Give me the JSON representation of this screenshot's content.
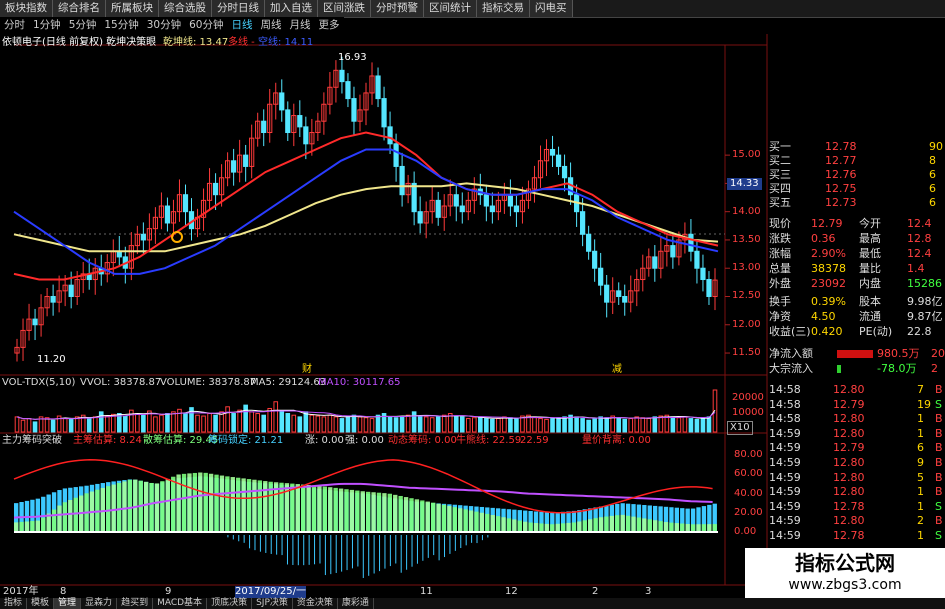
{
  "top_menu": [
    "板块指数",
    "综合排名",
    "所属板块",
    "综合选股",
    "分时日线",
    "加入自选",
    "区间涨跌",
    "分时预警",
    "区间统计",
    "指标交易",
    "闪电买"
  ],
  "periods": {
    "items": [
      "分时",
      "1分钟",
      "5分钟",
      "15分钟",
      "30分钟",
      "60分钟",
      "日线",
      "周线",
      "月线",
      "更多"
    ],
    "active": "日线"
  },
  "main_header": {
    "title": "依顿电子(日线 前复权) 乾坤决策眼",
    "indicator": "乾坤线: 13.47",
    "line2": "多线 -",
    "line3": "空线: 14.11"
  },
  "price_labels": {
    "high": "16.93",
    "low": "11.20"
  },
  "markers": {
    "cai": "财",
    "jian": "减"
  },
  "vol_header": {
    "name": "VOL-TDX(5,10)",
    "vvol": "VVOL: 38378.87",
    "volume": "VOLUME: 38378.87",
    "ma5": "MA5: 29124.63",
    "ma10": "MA10: 30117.65"
  },
  "chip_header": {
    "name": "主力筹码突破",
    "items": [
      "主筹估算: 8.24",
      "散筹估算: 29.45",
      "筹码锁定: 21.21",
      "涨: 0.00",
      "强: 0.00",
      "动态筹码: 0.00",
      "牛熊线: 22.59",
      "22.59",
      "量价背离: 0.00"
    ]
  },
  "axis": {
    "price_ticks": [
      "15.00",
      "14.50",
      "14.00",
      "13.50",
      "13.00",
      "12.50",
      "12.00",
      "11.50"
    ],
    "current_price_tag": "14.33",
    "vol_ticks": [
      "20000",
      "10000"
    ],
    "vol_unit": "X10",
    "chip_ticks": [
      "80.00",
      "60.00",
      "40.00",
      "20.00",
      "0.00"
    ],
    "date_labels": [
      "2017年",
      "8",
      "9",
      "2017/09/25/一",
      "11",
      "12",
      "2",
      "3"
    ]
  },
  "quote": {
    "buy": [
      {
        "label": "买一",
        "price": "12.78",
        "vol": "90"
      },
      {
        "label": "买二",
        "price": "12.77",
        "vol": "8"
      },
      {
        "label": "买三",
        "price": "12.76",
        "vol": "6"
      },
      {
        "label": "买四",
        "price": "12.75",
        "vol": "6"
      },
      {
        "label": "买五",
        "price": "12.73",
        "vol": "6"
      }
    ],
    "stats": [
      {
        "l1": "现价",
        "v1": "12.79",
        "l2": "今开",
        "v2": "12.4"
      },
      {
        "l1": "涨跌",
        "v1": "0.36",
        "l2": "最高",
        "v2": "12.8"
      },
      {
        "l1": "涨幅",
        "v1": "2.90%",
        "l2": "最低",
        "v2": "12.4"
      },
      {
        "l1": "总量",
        "v1": "38378",
        "l2": "量比",
        "v2": "1.4"
      },
      {
        "l1": "外盘",
        "v1": "23092",
        "l2": "内盘",
        "v2": "15286"
      },
      {
        "l1": "换手",
        "v1": "0.39%",
        "l2": "股本",
        "v2": "9.98亿"
      },
      {
        "l1": "净资",
        "v1": "4.50",
        "l2": "流通",
        "v2": "9.87亿"
      },
      {
        "l1": "收益(三)",
        "v1": "0.420",
        "l2": "PE(动)",
        "v2": "22.8"
      }
    ],
    "flow": [
      {
        "label": "净流入额",
        "value": "980.5万",
        "extra": "20"
      },
      {
        "label": "大宗流入",
        "value": "-78.0万",
        "extra": "2"
      }
    ],
    "ticks": [
      {
        "t": "14:58",
        "p": "12.80",
        "v": "7",
        "d": "B"
      },
      {
        "t": "14:58",
        "p": "12.79",
        "v": "19",
        "d": "S"
      },
      {
        "t": "14:58",
        "p": "12.80",
        "v": "1",
        "d": "B"
      },
      {
        "t": "14:59",
        "p": "12.80",
        "v": "1",
        "d": "B"
      },
      {
        "t": "14:59",
        "p": "12.79",
        "v": "6",
        "d": "B"
      },
      {
        "t": "14:59",
        "p": "12.80",
        "v": "9",
        "d": "B"
      },
      {
        "t": "14:59",
        "p": "12.80",
        "v": "5",
        "d": "B"
      },
      {
        "t": "14:59",
        "p": "12.80",
        "v": "1",
        "d": "B"
      },
      {
        "t": "14:59",
        "p": "12.78",
        "v": "1",
        "d": "S"
      },
      {
        "t": "14:59",
        "p": "12.80",
        "v": "2",
        "d": "B"
      },
      {
        "t": "14:59",
        "p": "12.78",
        "v": "1",
        "d": "S"
      }
    ]
  },
  "bottom_tabs": {
    "items": [
      "指标",
      "模板",
      "管理",
      "显森力",
      "趋买到",
      "MACD基本",
      "顶底决策",
      "SJP决策",
      "资金决策",
      "康彩通"
    ],
    "active": "管理"
  },
  "watermark": {
    "text1": "指标公式网",
    "text2": "www.zbgs3.com"
  },
  "colors": {
    "up": "#ff3b3b",
    "down": "#55e6ff",
    "yellow_line": "#f0e68c",
    "red_line": "#ff2a2a",
    "blue_line": "#2a3cff",
    "chip_green": "#7dff7d",
    "chip_cyan": "#3cc8ff",
    "purple_line": "#c050ff",
    "quote_up": "#ff4040",
    "quote_down": "#40ff40"
  },
  "chart_data": [
    {
      "type": "candlestick",
      "title": "依顿电子(日线 前复权)",
      "ylim": [
        11.2,
        16.93
      ],
      "ticks": [
        15.0,
        14.5,
        14.0,
        13.5,
        13.0,
        12.5,
        12.0,
        11.5
      ],
      "close": [
        11.6,
        11.9,
        12.1,
        12.0,
        12.3,
        12.5,
        12.4,
        12.6,
        12.7,
        12.5,
        12.8,
        12.9,
        12.8,
        13.0,
        12.9,
        13.1,
        13.3,
        13.2,
        13.0,
        13.4,
        13.6,
        13.5,
        13.7,
        13.9,
        14.1,
        13.8,
        14.0,
        14.3,
        14.0,
        13.7,
        13.9,
        14.2,
        14.5,
        14.3,
        14.6,
        14.9,
        14.7,
        15.0,
        14.8,
        15.3,
        15.6,
        15.4,
        15.9,
        16.1,
        15.8,
        15.4,
        15.7,
        15.5,
        15.2,
        15.4,
        15.6,
        15.9,
        16.2,
        16.5,
        16.3,
        16.0,
        15.6,
        15.8,
        16.1,
        16.4,
        16.0,
        15.5,
        15.2,
        14.8,
        14.3,
        14.5,
        14.0,
        13.8,
        14.0,
        14.2,
        13.9,
        14.1,
        14.3,
        14.1,
        14.0,
        14.2,
        14.4,
        14.3,
        14.1,
        14.0,
        14.2,
        14.3,
        14.1,
        14.0,
        14.2,
        14.4,
        14.6,
        14.9,
        15.1,
        15.0,
        14.8,
        14.6,
        14.3,
        14.0,
        13.6,
        13.3,
        13.0,
        12.7,
        12.4,
        12.6,
        12.5,
        12.4,
        12.6,
        12.8,
        13.0,
        13.2,
        13.0,
        13.3,
        13.4,
        13.2,
        13.5,
        13.6,
        13.3,
        13.0,
        12.8,
        12.5,
        12.79
      ],
      "series": [
        {
          "name": "乾坤线",
          "values": [
            13.6,
            13.5,
            13.4,
            13.3,
            13.3,
            13.3,
            13.3,
            13.4,
            13.5,
            13.6,
            13.75,
            13.95,
            14.15,
            14.3,
            14.4,
            14.45,
            14.45,
            14.45,
            14.5,
            14.45,
            14.4,
            14.3,
            14.2,
            14.1,
            13.95,
            13.8,
            13.65,
            13.5,
            13.47
          ]
        },
        {
          "name": "多线",
          "values": [
            12.9,
            12.8,
            12.8,
            12.9,
            13.0,
            13.2,
            13.5,
            13.8,
            14.1,
            14.4,
            14.7,
            14.9,
            15.1,
            15.3,
            15.4,
            15.3,
            15.0,
            14.6,
            14.4,
            14.3,
            14.3,
            14.4,
            14.5,
            14.3,
            14.0,
            13.8,
            13.6,
            13.5,
            13.4
          ]
        },
        {
          "name": "空线",
          "values": [
            14.0,
            13.7,
            13.4,
            13.1,
            12.9,
            12.9,
            13.0,
            13.2,
            13.4,
            13.7,
            14.0,
            14.3,
            14.6,
            14.9,
            15.1,
            15.1,
            14.9,
            14.6,
            14.4,
            14.3,
            14.3,
            14.4,
            14.4,
            14.2,
            13.9,
            13.7,
            13.5,
            13.4,
            13.3
          ]
        }
      ]
    },
    {
      "type": "bar",
      "title": "VOL-TDX(5,10)",
      "ylim": [
        0,
        25000
      ],
      "values": [
        9000,
        7000,
        8000,
        6000,
        9000,
        8500,
        7000,
        9500,
        8000,
        7500,
        9000,
        10000,
        8500,
        9000,
        12000,
        9500,
        10500,
        11000,
        9500,
        13000,
        11000,
        10000,
        12500,
        9000,
        10000,
        11000,
        12000,
        13500,
        11000,
        14500,
        10000,
        9500,
        11000,
        10000,
        12000,
        15000,
        11000,
        13000,
        16000,
        12000,
        11000,
        10000,
        14000,
        18000,
        12000,
        11000,
        10000,
        9000,
        12000,
        10000,
        9500,
        9000,
        10000,
        9000,
        8000,
        9500,
        10000,
        9000,
        8500,
        8000,
        10000,
        11000,
        9000,
        8500,
        9000,
        10000,
        12000,
        9500,
        9000,
        8500,
        9000,
        10000,
        11000,
        9500,
        9000,
        8000,
        8500,
        9000,
        8000,
        7500,
        8000,
        9000,
        8500,
        8000,
        9500,
        10000,
        9000,
        8000,
        7500,
        8000,
        8500,
        9000,
        10000,
        9000,
        8000,
        7000,
        8000,
        9000,
        8500,
        9500,
        8000,
        7500,
        8000,
        9000,
        8500,
        8000,
        9000,
        9500,
        10000,
        9000,
        8500,
        9000,
        8000,
        7500,
        8000,
        9000,
        38378.87
      ],
      "lines": [
        {
          "name": "MA5",
          "last": 29124.63
        },
        {
          "name": "MA10",
          "last": 30117.65
        }
      ]
    },
    {
      "type": "area",
      "title": "主力筹码突破",
      "ylim": [
        -50,
        90
      ],
      "ticks": [
        80,
        60,
        40,
        20,
        0
      ],
      "series": [
        {
          "name": "散筹估算",
          "values": [
            30,
            35,
            45,
            48,
            52,
            55,
            50,
            56,
            58,
            55,
            52,
            50,
            48,
            45,
            42,
            40,
            36,
            32,
            30,
            28,
            26,
            24,
            22,
            20,
            22,
            26,
            30,
            28,
            26,
            24,
            29.45
          ]
        },
        {
          "name": "主筹估算",
          "values": [
            10,
            12,
            30,
            40,
            48,
            55,
            50,
            60,
            62,
            58,
            55,
            52,
            50,
            48,
            45,
            42,
            40,
            35,
            30,
            25,
            20,
            15,
            10,
            8,
            10,
            15,
            18,
            14,
            10,
            8,
            8.24
          ]
        },
        {
          "name": "筹码锁定",
          "values": [
            5,
            6,
            8,
            10,
            12,
            15,
            20,
            24,
            28,
            30,
            32,
            34,
            36,
            38,
            40,
            40,
            38,
            36,
            35,
            34,
            33,
            32,
            30,
            29,
            28,
            27,
            26,
            25,
            24,
            22,
            21.21
          ]
        }
      ]
    }
  ]
}
